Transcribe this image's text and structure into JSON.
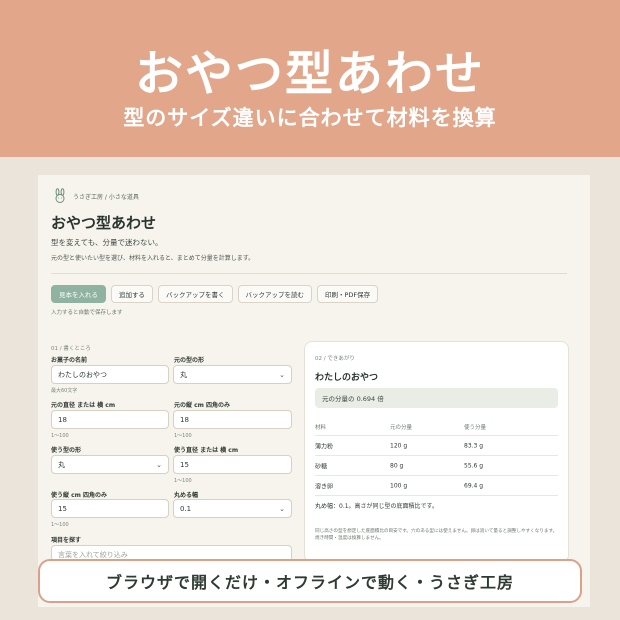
{
  "banner": {
    "title": "おやつ型あわせ",
    "subtitle": "型のサイズ違いに合わせて材料を換算"
  },
  "app": {
    "breadcrumb": "うさぎ工房 / 小さな道具",
    "title": "おやつ型あわせ",
    "tagline": "型を変えても、分量で迷わない。",
    "description": "元の型と使いたい型を選び、材料を入れると、まとめて分量を計算します。"
  },
  "toolbar": {
    "example": "見本を入れる",
    "add": "追加する",
    "backup_write": "バックアップを書く",
    "backup_read": "バックアップを読む",
    "print": "印刷・PDF保存",
    "autosave_note": "入力すると自動で保存します"
  },
  "form": {
    "section": "01 / 書くところ",
    "name_label": "お菓子の名前",
    "name_value": "わたしのおやつ",
    "name_hint": "最大60文字",
    "orig_shape_label": "元の型の形",
    "orig_shape_value": "丸",
    "orig_dim_label": "元の直径 または 横 cm",
    "orig_dim_value": "18",
    "orig_dim_hint": "1〜100",
    "orig_depth_label": "元の縦 cm 四角のみ",
    "orig_depth_value": "18",
    "orig_depth_hint": "1〜100",
    "use_shape_label": "使う型の形",
    "use_shape_value": "丸",
    "use_dim_label": "使う直径 または 横 cm",
    "use_dim_value": "15",
    "use_dim_hint": "1〜100",
    "use_depth_label": "使う縦 cm 四角のみ",
    "use_depth_value": "15",
    "use_depth_hint": "1〜100",
    "round_label": "丸める幅",
    "round_value": "0.1",
    "search_label": "項目を探す",
    "search_placeholder": "言葉を入れて絞り込み"
  },
  "result": {
    "section": "02 / できあがり",
    "title": "わたしのおやつ",
    "ratio_text": "元の分量の 0.694 倍",
    "columns": [
      "材料",
      "元の分量",
      "使う分量"
    ],
    "rows": [
      [
        "薄力粉",
        "120 g",
        "83.3 g"
      ],
      [
        "砂糖",
        "80 g",
        "55.6 g"
      ],
      [
        "溶き卵",
        "100 g",
        "69.4 g"
      ]
    ],
    "note_main": "丸め幅：0.1。高さが同じ型の底面積比です。",
    "note_small": "同じ高さの型を想定した底面積比の目安です。穴のある型には使えません。卵は溶いて量ると調整しやすくなります。焼き時間・温度は換算しません。"
  },
  "footer": {
    "text": "ブラウザで開くだけ・オフラインで動く・うさぎ工房"
  },
  "colors": {
    "banner": "#e2a68b",
    "accent": "#8fb3a0",
    "page": "#f7f4ee"
  }
}
